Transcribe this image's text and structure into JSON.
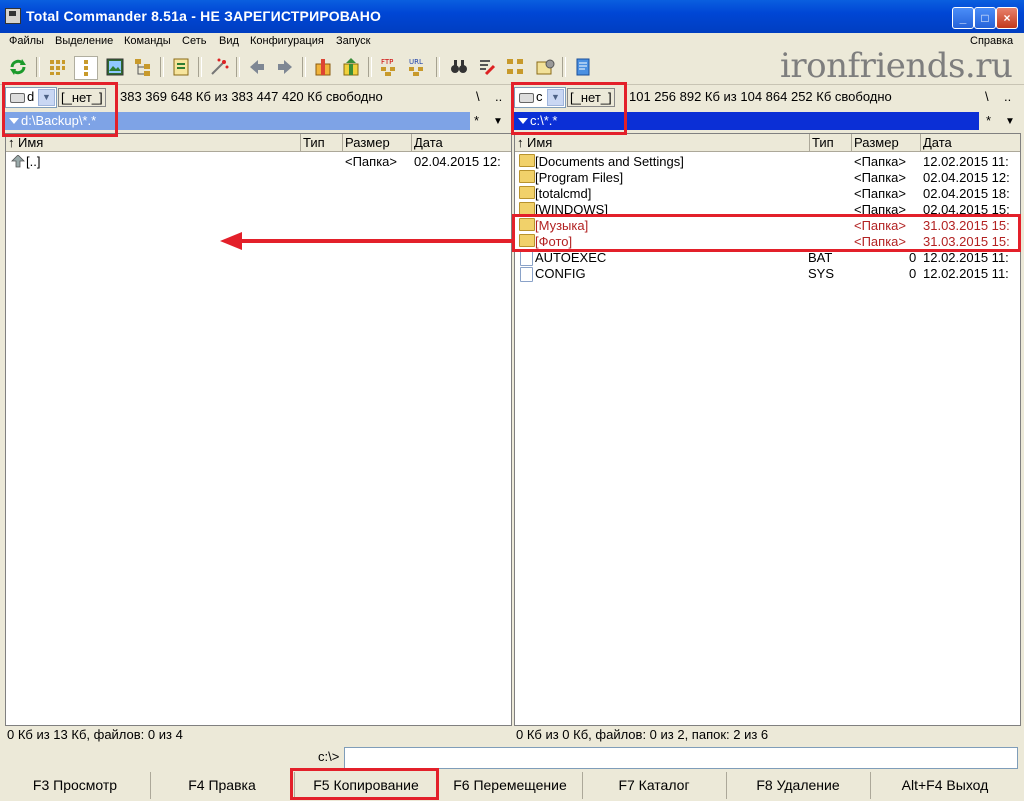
{
  "window": {
    "title": "Total Commander 8.51a - НЕ ЗАРЕГИСТРИРОВАНО",
    "minimize": "_",
    "maximize": "□",
    "close": "×"
  },
  "menu": {
    "files": "Файлы",
    "selection": "Выделение",
    "commands": "Команды",
    "network": "Сеть",
    "view": "Вид",
    "configuration": "Конфигурация",
    "launch": "Запуск",
    "help": "Справка"
  },
  "toolbar_labels": {
    "ftp": "FTP",
    "url": "URL"
  },
  "watermark": "ironfriends.ru",
  "left": {
    "drive": "d",
    "label": "[_нет_]",
    "free": "383 369 648 Кб из 383 447 420 Кб свободно",
    "root_btn": "\\",
    "up_btn": "..",
    "path": "d:\\Backup\\*.*",
    "filter": "*",
    "columns": {
      "name": "Имя",
      "type": "Тип",
      "size": "Размер",
      "date": "Дата"
    },
    "rows": [
      {
        "name": "[..]",
        "type": "",
        "size": "<Папка>",
        "date": "02.04.2015 12:"
      }
    ],
    "status": "0 Кб из 13 Кб, файлов: 0 из 4"
  },
  "right": {
    "drive": "c",
    "label": "[_нет_]",
    "free": "101 256 892 Кб из 104 864 252 Кб свободно",
    "root_btn": "\\",
    "up_btn": "..",
    "path": "c:\\*.*",
    "filter": "*",
    "columns": {
      "name": "Имя",
      "type": "Тип",
      "size": "Размер",
      "date": "Дата"
    },
    "rows": [
      {
        "name": "[Documents and Settings]",
        "type": "",
        "size": "<Папка>",
        "date": "12.02.2015 11:"
      },
      {
        "name": "[Program Files]",
        "type": "",
        "size": "<Папка>",
        "date": "02.04.2015 12:"
      },
      {
        "name": "[totalcmd]",
        "type": "",
        "size": "<Папка>",
        "date": "02.04.2015 18:"
      },
      {
        "name": "[WINDOWS]",
        "type": "",
        "size": "<Папка>",
        "date": "02.04.2015 15:"
      },
      {
        "name": "[Музыка]",
        "type": "",
        "size": "<Папка>",
        "date": "31.03.2015 15:"
      },
      {
        "name": "[Фото]",
        "type": "",
        "size": "<Папка>",
        "date": "31.03.2015 15:"
      },
      {
        "name": "AUTOEXEC",
        "type": "BAT",
        "size": "0",
        "date": "12.02.2015 11:"
      },
      {
        "name": "CONFIG",
        "type": "SYS",
        "size": "0",
        "date": "12.02.2015 11:"
      }
    ],
    "status": "0 Кб из 0 Кб, файлов: 0 из 2, папок: 2 из 6"
  },
  "cmdline": {
    "label": "c:\\>",
    "value": ""
  },
  "fkeys": [
    "F3 Просмотр",
    "F4 Правка",
    "F5 Копирование",
    "F6 Перемещение",
    "F7 Каталог",
    "F8 Удаление",
    "Alt+F4 Выход"
  ],
  "colors": {
    "title_blue": "#0046d5",
    "path_active": "#0a246a",
    "path_inactive": "#7ea3e6",
    "highlight": "#e3202a",
    "selected_text": "#b22222"
  }
}
